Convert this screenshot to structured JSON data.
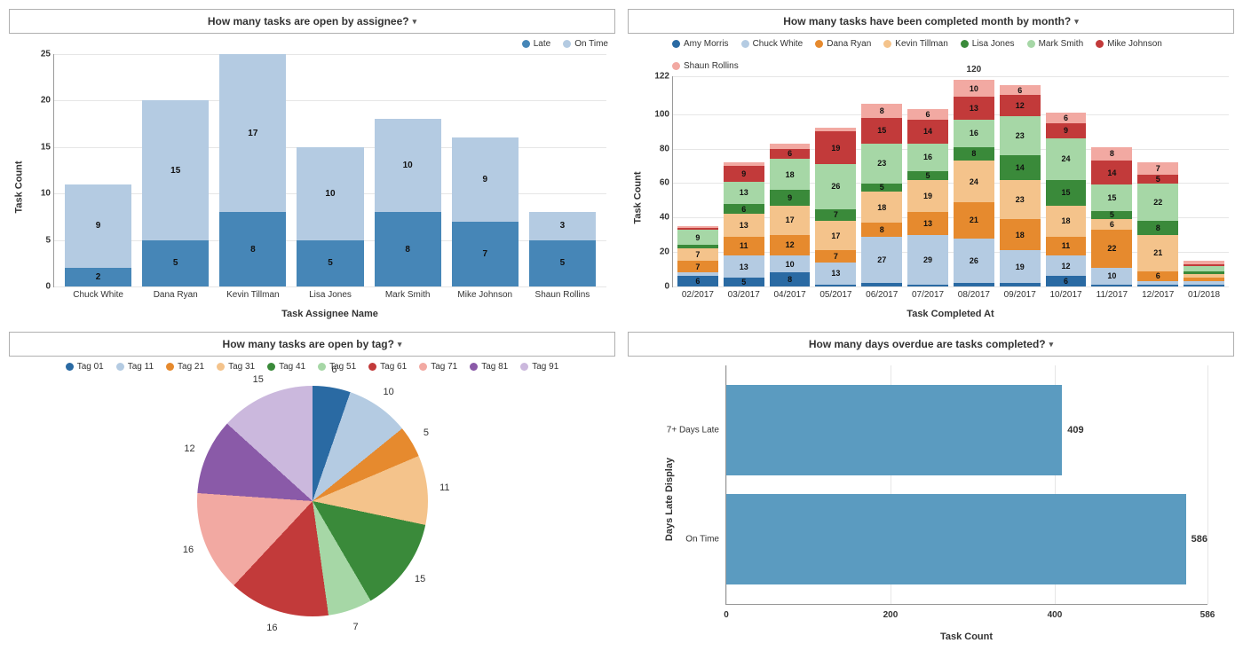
{
  "chart_data": [
    {
      "id": "open_by_assignee",
      "type": "bar",
      "stacked": true,
      "title": "How many tasks are open by assignee?",
      "xlabel": "Task Assignee Name",
      "ylabel": "Task Count",
      "ylim": [
        0,
        25
      ],
      "yticks": [
        0,
        5,
        10,
        15,
        20,
        25
      ],
      "legend_position": "top-right",
      "categories": [
        "Chuck White",
        "Dana Ryan",
        "Kevin Tillman",
        "Lisa Jones",
        "Mark Smith",
        "Mike Johnson",
        "Shaun Rollins"
      ],
      "series": [
        {
          "name": "Late",
          "color": "#4686b7",
          "values": [
            2,
            5,
            8,
            5,
            8,
            7,
            5
          ]
        },
        {
          "name": "On Time",
          "color": "#b4cbe2",
          "values": [
            9,
            15,
            17,
            10,
            10,
            9,
            3
          ]
        }
      ]
    },
    {
      "id": "completed_by_month",
      "type": "bar",
      "stacked": true,
      "title": "How many tasks have been completed month by month?",
      "xlabel": "Task Completed At",
      "ylabel": "Task Count",
      "ylim": [
        0,
        122
      ],
      "yticks": [
        0,
        20,
        40,
        60,
        80,
        100,
        122
      ],
      "legend_position": "top-left",
      "categories": [
        "02/2017",
        "03/2017",
        "04/2017",
        "05/2017",
        "06/2017",
        "07/2017",
        "08/2017",
        "09/2017",
        "10/2017",
        "11/2017",
        "12/2017",
        "01/2018"
      ],
      "series": [
        {
          "name": "Amy Morris",
          "color": "#2a6aa3",
          "values": [
            6,
            5,
            8,
            1,
            2,
            1,
            2,
            2,
            6,
            1,
            1,
            1
          ]
        },
        {
          "name": "Chuck White",
          "color": "#b4cbe2",
          "values": [
            2,
            13,
            10,
            13,
            27,
            29,
            26,
            19,
            12,
            10,
            2,
            2
          ]
        },
        {
          "name": "Dana Ryan",
          "color": "#e68a2e",
          "values": [
            7,
            11,
            12,
            7,
            8,
            13,
            21,
            18,
            11,
            22,
            6,
            2
          ]
        },
        {
          "name": "Kevin Tillman",
          "color": "#f4c38b",
          "values": [
            7,
            13,
            17,
            17,
            18,
            19,
            24,
            23,
            18,
            6,
            21,
            2
          ]
        },
        {
          "name": "Lisa Jones",
          "color": "#3a8a3a",
          "values": [
            2,
            6,
            9,
            7,
            5,
            5,
            8,
            14,
            15,
            5,
            8,
            2
          ]
        },
        {
          "name": "Mark Smith",
          "color": "#a6d7a6",
          "values": [
            9,
            13,
            18,
            26,
            23,
            16,
            16,
            23,
            24,
            15,
            22,
            3
          ]
        },
        {
          "name": "Mike Johnson",
          "color": "#c23a3a",
          "values": [
            1,
            9,
            6,
            19,
            15,
            14,
            13,
            12,
            9,
            14,
            5,
            1
          ]
        },
        {
          "name": "Shaun Rollins",
          "color": "#f2a9a2",
          "values": [
            1,
            2,
            3,
            2,
            8,
            6,
            10,
            6,
            6,
            8,
            7,
            2
          ]
        }
      ]
    },
    {
      "id": "open_by_tag",
      "type": "pie",
      "title": "How many tasks are open by tag?",
      "legend_position": "top-center",
      "slices": [
        {
          "name": "Tag 01",
          "color": "#2a6aa3",
          "value": 6
        },
        {
          "name": "Tag 11",
          "color": "#b4cbe2",
          "value": 10
        },
        {
          "name": "Tag 21",
          "color": "#e68a2e",
          "value": 5
        },
        {
          "name": "Tag 31",
          "color": "#f4c38b",
          "value": 11
        },
        {
          "name": "Tag 41",
          "color": "#3a8a3a",
          "value": 15
        },
        {
          "name": "Tag 51",
          "color": "#a6d7a6",
          "value": 7
        },
        {
          "name": "Tag 61",
          "color": "#c23a3a",
          "value": 16
        },
        {
          "name": "Tag 71",
          "color": "#f2a9a2",
          "value": 16
        },
        {
          "name": "Tag 81",
          "color": "#8a5aa8",
          "value": 12
        },
        {
          "name": "Tag 91",
          "color": "#cbb8dd",
          "value": 15
        }
      ]
    },
    {
      "id": "days_overdue",
      "type": "bar",
      "orientation": "horizontal",
      "title": "How many days overdue are tasks completed?",
      "xlabel": "Task Count",
      "ylabel": "Days Late Display",
      "xlim": [
        0,
        586
      ],
      "xticks": [
        0,
        200,
        400,
        586
      ],
      "categories": [
        "7+ Days Late",
        "On Time"
      ],
      "values": [
        409,
        586
      ],
      "bar_color": "#5b9bc0"
    }
  ]
}
